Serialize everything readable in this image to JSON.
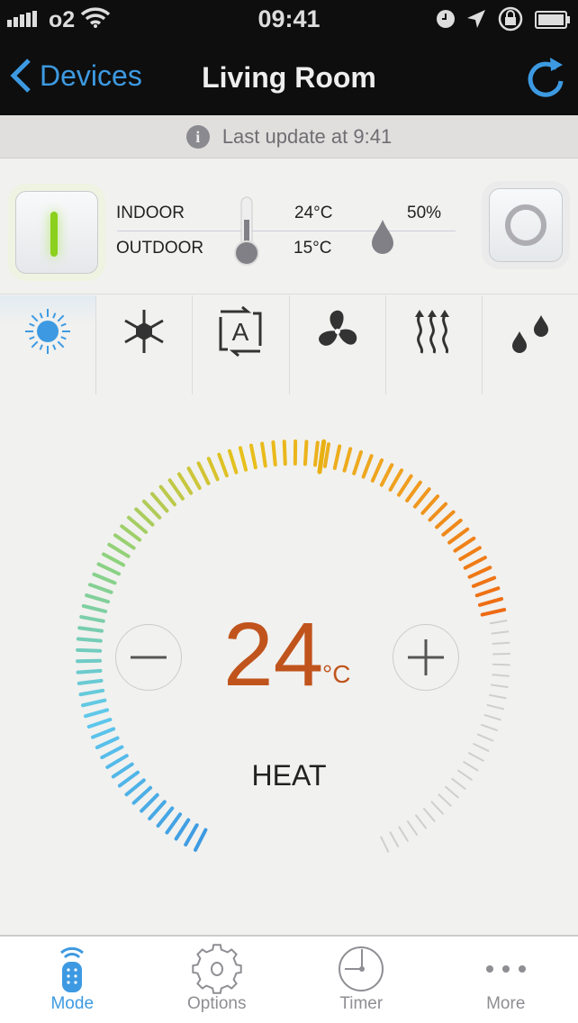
{
  "status_bar": {
    "carrier": "o2",
    "time": "09:41"
  },
  "nav": {
    "back_label": "Devices",
    "title": "Living Room"
  },
  "update": {
    "text": "Last update at 9:41",
    "icon": "info-icon"
  },
  "readings": {
    "indoor_label": "INDOOR",
    "outdoor_label": "OUTDOOR",
    "indoor_temp": "24°C",
    "outdoor_temp": "15°C",
    "humidity": "50%"
  },
  "modes": [
    {
      "name": "heat",
      "icon": "sun-icon",
      "active": true
    },
    {
      "name": "cool",
      "icon": "snowflake-icon"
    },
    {
      "name": "auto",
      "icon": "auto-icon",
      "label": "A"
    },
    {
      "name": "fan",
      "icon": "fan-icon"
    },
    {
      "name": "heat-waves",
      "icon": "heat-waves-icon"
    },
    {
      "name": "dry",
      "icon": "droplets-icon"
    }
  ],
  "dial": {
    "setpoint": "24",
    "unit": "°C",
    "mode_label": "HEAT",
    "level_percent": 75,
    "colors": [
      "#3d9ae2",
      "#5ec8ec",
      "#8fd27c",
      "#e8c01a",
      "#f0a020",
      "#ee6a12"
    ],
    "inactive_color": "#cfcfcf"
  },
  "tabs": [
    {
      "label": "Mode",
      "icon": "remote-icon",
      "active": true
    },
    {
      "label": "Options",
      "icon": "gear-icon"
    },
    {
      "label": "Timer",
      "icon": "clock-icon"
    },
    {
      "label": "More",
      "icon": "more-icon"
    }
  ],
  "accent": "#3d9ae2"
}
